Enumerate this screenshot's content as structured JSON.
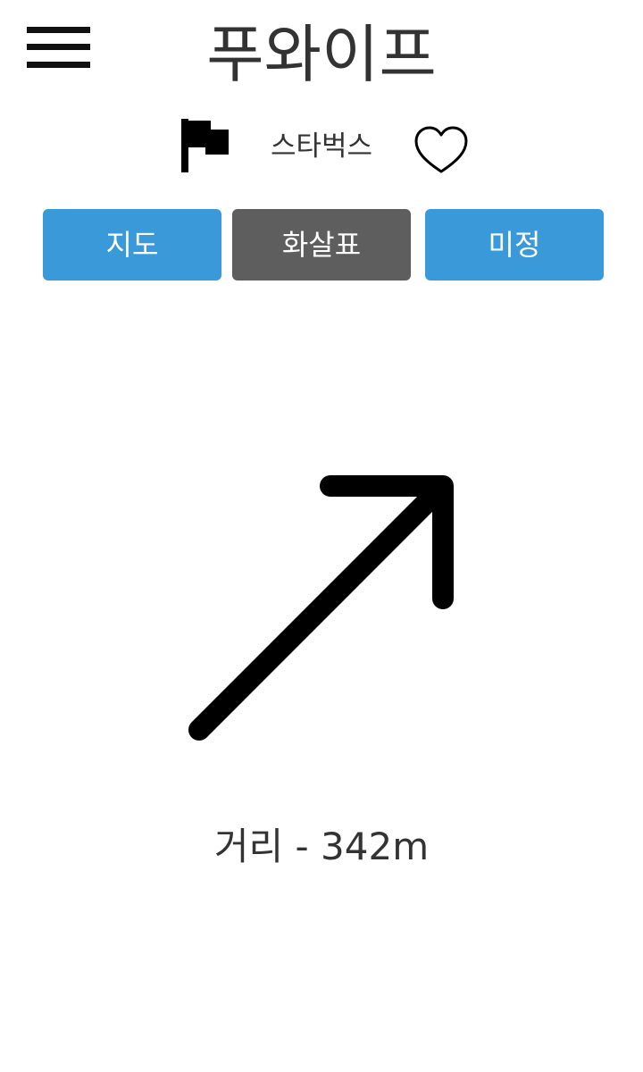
{
  "header": {
    "title": "푸와이프",
    "menu_icon": "hamburger-menu-icon"
  },
  "place": {
    "flag_icon": "flag-icon",
    "name": "스타벅스",
    "favorite_icon": "heart-outline-icon"
  },
  "tabs": [
    {
      "label": "지도",
      "active": false,
      "color": "#3a9ad9"
    },
    {
      "label": "화살표",
      "active": true,
      "color": "#5e5e5e"
    },
    {
      "label": "미정",
      "active": false,
      "color": "#3a9ad9"
    }
  ],
  "navigation": {
    "arrow_icon": "arrow-up-right-icon",
    "distance_label": "거리 - 342m"
  }
}
